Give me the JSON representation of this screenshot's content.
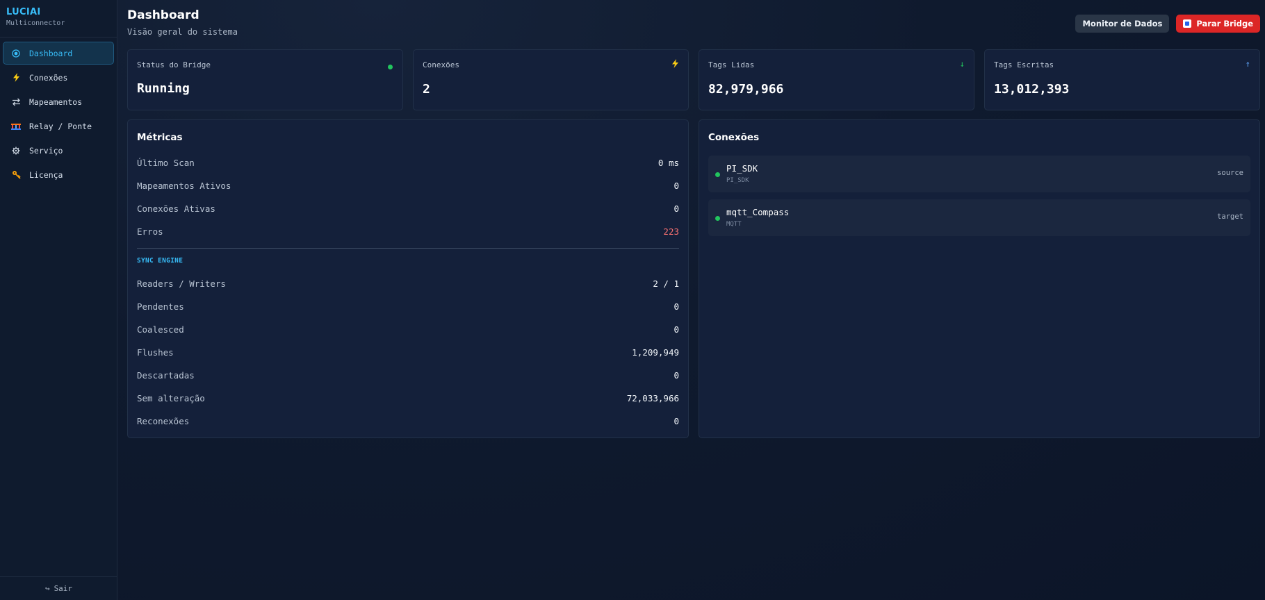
{
  "sidebar": {
    "brand": "LUCIAI",
    "subtitle": "Multiconnector",
    "items": [
      {
        "label": "Dashboard",
        "icon": "target-icon"
      },
      {
        "label": "Conexões",
        "icon": "lightning-icon"
      },
      {
        "label": "Mapeamentos",
        "icon": "swap-arrows-icon"
      },
      {
        "label": "Relay / Ponte",
        "icon": "bridge-icon"
      },
      {
        "label": "Serviço",
        "icon": "gear-icon"
      },
      {
        "label": "Licença",
        "icon": "key-icon"
      }
    ],
    "logout": "Sair",
    "logout_icon": "logout-arrow-icon"
  },
  "header": {
    "title": "Dashboard",
    "subtitle": "Visão geral do sistema",
    "monitor_button": "Monitor de Dados",
    "stop_button": "Parar Bridge"
  },
  "stats": [
    {
      "label": "Status do Bridge",
      "value": "Running",
      "icon": "status-dot-icon"
    },
    {
      "label": "Conexões",
      "value": "2",
      "icon": "lightning-icon"
    },
    {
      "label": "Tags Lidas",
      "value": "82,979,966",
      "icon": "arrow-down-icon"
    },
    {
      "label": "Tags Escritas",
      "value": "13,012,393",
      "icon": "arrow-up-icon"
    }
  ],
  "metrics": {
    "title": "Métricas",
    "rows": [
      {
        "label": "Último Scan",
        "value": "0 ms"
      },
      {
        "label": "Mapeamentos Ativos",
        "value": "0"
      },
      {
        "label": "Conexões Ativas",
        "value": "0"
      },
      {
        "label": "Erros",
        "value": "223"
      }
    ],
    "sync_title": "SYNC ENGINE",
    "sync_rows": [
      {
        "label": "Readers / Writers",
        "value": "2 / 1"
      },
      {
        "label": "Pendentes",
        "value": "0"
      },
      {
        "label": "Coalesced",
        "value": "0"
      },
      {
        "label": "Flushes",
        "value": "1,209,949"
      },
      {
        "label": "Descartadas",
        "value": "0"
      },
      {
        "label": "Sem alteração",
        "value": "72,033,966"
      },
      {
        "label": "Reconexões",
        "value": "0"
      }
    ]
  },
  "connections": {
    "title": "Conexões",
    "items": [
      {
        "name": "PI_SDK",
        "type": "PI_SDK",
        "role": "source"
      },
      {
        "name": "mqtt_Compass",
        "type": "MQTT",
        "role": "target"
      }
    ]
  },
  "colors": {
    "accent": "#38bdf8",
    "danger": "#dc2626",
    "success": "#22c55e",
    "error_text": "#f87171"
  }
}
